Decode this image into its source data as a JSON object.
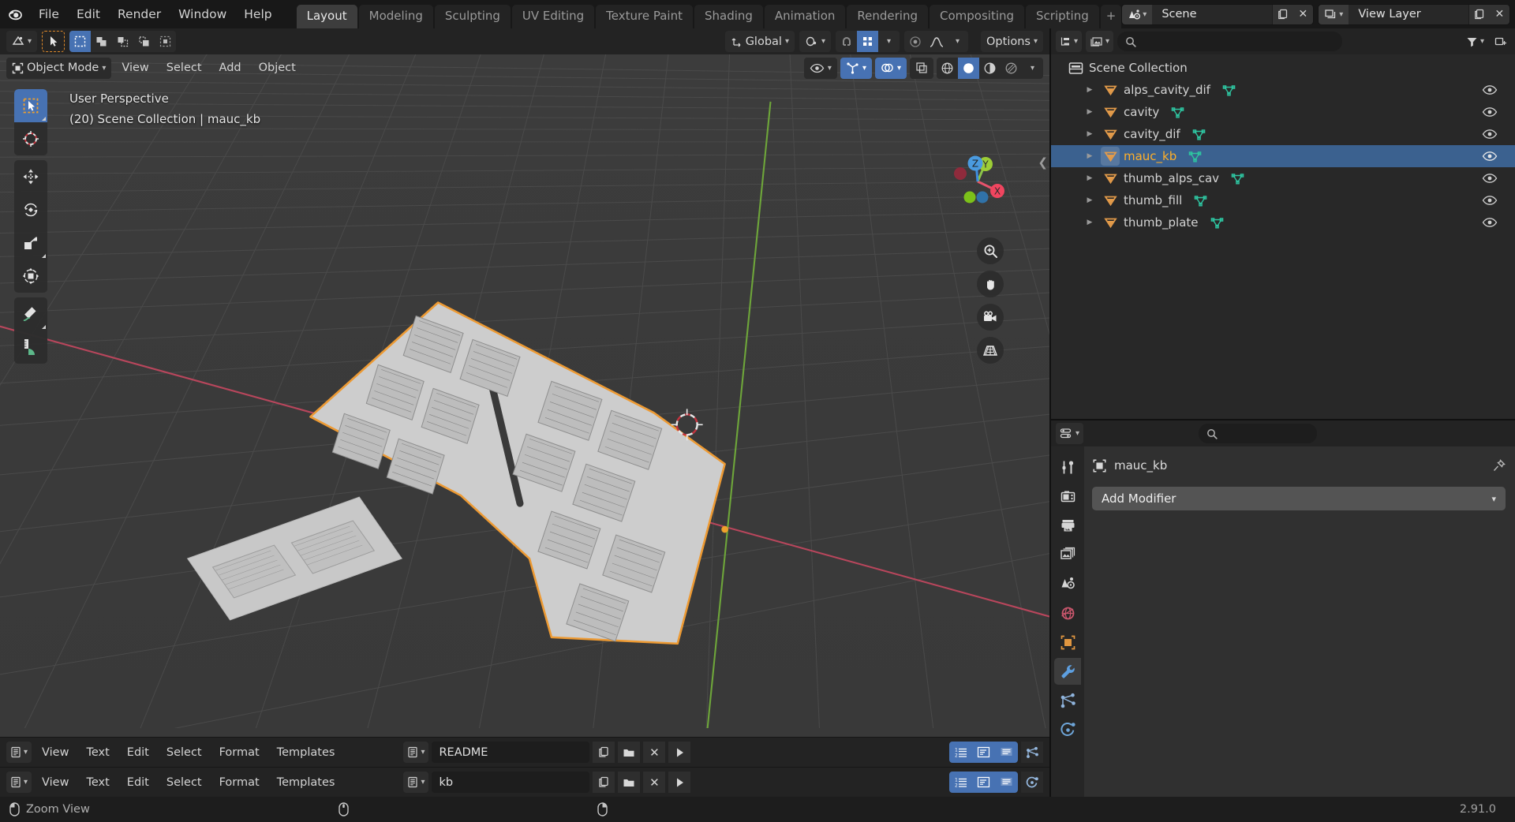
{
  "app": {
    "title": "Blender",
    "version": "2.91.0"
  },
  "topbar": {
    "logo_icon": "blender-logo-icon",
    "menus": [
      "File",
      "Edit",
      "Render",
      "Window",
      "Help"
    ],
    "workspace_tabs": [
      {
        "label": "Layout",
        "active": true
      },
      {
        "label": "Modeling",
        "active": false
      },
      {
        "label": "Sculpting",
        "active": false
      },
      {
        "label": "UV Editing",
        "active": false
      },
      {
        "label": "Texture Paint",
        "active": false
      },
      {
        "label": "Shading",
        "active": false
      },
      {
        "label": "Animation",
        "active": false
      },
      {
        "label": "Rendering",
        "active": false
      },
      {
        "label": "Compositing",
        "active": false
      },
      {
        "label": "Scripting",
        "active": false
      }
    ],
    "scene": {
      "icon": "scene-icon",
      "name": "Scene",
      "new_icon": "copy-icon",
      "unlink_icon": "close-icon"
    },
    "view_layer": {
      "icon": "view-layer-icon",
      "name": "View Layer",
      "new_icon": "copy-icon",
      "unlink_icon": "close-icon"
    }
  },
  "viewport_header": {
    "editor_type_icon": "editor-type-3dview-icon",
    "select_tool_icon": "cursor-arrow-icon",
    "select_modes": [
      "select-box-icon",
      "select-extend-icon",
      "select-subtract-icon",
      "select-invert-icon",
      "select-intersect-icon"
    ],
    "transform_orientation": {
      "icon": "orientation-icon",
      "value": "Global"
    },
    "pivot_icon": "pivot-point-icon",
    "snap_icon": "magnet-icon",
    "snap_to_icon": "snap-grid-icon",
    "proportional_icon": "proportional-edit-icon",
    "falloff_icon": "falloff-curve-icon",
    "options_label": "Options"
  },
  "viewport_header2": {
    "mode": {
      "icon": "object-mode-icon",
      "label": "Object Mode"
    },
    "menus": [
      "View",
      "Select",
      "Add",
      "Object"
    ],
    "visibility_icon": "eye-icon",
    "gizmo_icon": "gizmo-icon",
    "overlays_icon": "overlays-icon",
    "xray_icon": "xray-icon",
    "shading_modes": [
      "shading-wireframe-icon",
      "shading-solid-icon",
      "shading-material-icon",
      "shading-rendered-icon"
    ],
    "shading_active_index": 1
  },
  "viewport": {
    "overlay_line1": "User Perspective",
    "overlay_line2": "(20) Scene Collection | mauc_kb",
    "toolbar": [
      {
        "name": "tweak-tool",
        "icon": "cursor-arrow-icon",
        "active": true
      },
      {
        "name": "cursor-tool",
        "icon": "3d-cursor-icon",
        "active": false
      },
      {
        "name": "move-tool",
        "icon": "move-arrows-icon",
        "active": false
      },
      {
        "name": "rotate-tool",
        "icon": "rotate-icon",
        "active": false
      },
      {
        "name": "scale-tool",
        "icon": "scale-icon",
        "active": false
      },
      {
        "name": "transform-tool",
        "icon": "transform-icon",
        "active": false
      },
      {
        "name": "annotate-tool",
        "icon": "pencil-icon",
        "active": false
      },
      {
        "name": "measure-tool",
        "icon": "ruler-icon",
        "active": false
      }
    ],
    "nav_gizmo": {
      "axes": [
        {
          "label": "X",
          "color": "#e8536c"
        },
        {
          "label": "Y",
          "color": "#8bc34a"
        },
        {
          "label": "Z",
          "color": "#3d8ee0"
        }
      ]
    },
    "nav_buttons": [
      {
        "name": "zoom-button",
        "icon": "zoom-magnifier-icon"
      },
      {
        "name": "pan-button",
        "icon": "hand-icon"
      },
      {
        "name": "camera-view-button",
        "icon": "camera-icon"
      },
      {
        "name": "toggle-perspective-button",
        "icon": "grid-perspective-icon"
      }
    ],
    "collapse_icon": "chevron-left-icon",
    "grid_color": "#4a4a4a",
    "background_color": "#393939",
    "x_axis_color": "#b8465c",
    "y_axis_color": "#6ea63a",
    "selection_outline_color": "#ed9a33",
    "object_color": "#c6c6c6"
  },
  "outliner": {
    "editor_type_icon": "editor-type-outliner-icon",
    "display_mode_icon": "outliner-display-mode-icon",
    "search_icon": "search-icon",
    "search_placeholder": "",
    "filter_icon": "filter-funnel-icon",
    "new_collection_icon": "new-collection-icon",
    "root": {
      "icon": "collection-icon",
      "label": "Scene Collection"
    },
    "items": [
      {
        "label": "alps_cavity_dif",
        "icon": "mesh-object-icon",
        "mesh_icon": "mesh-data-icon",
        "selected": false,
        "visible": true
      },
      {
        "label": "cavity",
        "icon": "mesh-object-icon",
        "mesh_icon": "mesh-data-icon",
        "selected": false,
        "visible": true
      },
      {
        "label": "cavity_dif",
        "icon": "mesh-object-icon",
        "mesh_icon": "mesh-data-icon",
        "selected": false,
        "visible": true
      },
      {
        "label": "mauc_kb",
        "icon": "mesh-object-icon",
        "mesh_icon": "mesh-data-icon",
        "selected": true,
        "visible": true
      },
      {
        "label": "thumb_alps_cav",
        "icon": "mesh-object-icon",
        "mesh_icon": "mesh-data-icon",
        "selected": false,
        "visible": true
      },
      {
        "label": "thumb_fill",
        "icon": "mesh-object-icon",
        "mesh_icon": "mesh-data-icon",
        "selected": false,
        "visible": true
      },
      {
        "label": "thumb_plate",
        "icon": "mesh-object-icon",
        "mesh_icon": "mesh-data-icon",
        "selected": false,
        "visible": true
      }
    ]
  },
  "properties": {
    "editor_type_icon": "editor-type-properties-icon",
    "search_icon": "search-icon",
    "tabs": [
      {
        "name": "tool",
        "icon": "tool-screwdriver-wrench-icon",
        "active": false
      },
      {
        "name": "render",
        "icon": "render-camera-back-icon",
        "active": false
      },
      {
        "name": "output",
        "icon": "output-printer-icon",
        "active": false
      },
      {
        "name": "view-layer",
        "icon": "view-layer-images-icon",
        "active": false
      },
      {
        "name": "scene",
        "icon": "scene-cone-sphere-icon",
        "active": false
      },
      {
        "name": "world",
        "icon": "world-globe-icon",
        "active": false
      },
      {
        "name": "object",
        "icon": "object-square-icon",
        "active": false
      },
      {
        "name": "modifier",
        "icon": "wrench-icon",
        "active": true
      },
      {
        "name": "particles",
        "icon": "particles-icon",
        "active": false
      },
      {
        "name": "physics",
        "icon": "physics-orbit-icon",
        "active": false
      }
    ],
    "breadcrumb": {
      "icon": "object-square-icon",
      "label": "mauc_kb",
      "pin_icon": "pin-icon"
    },
    "add_modifier_label": "Add Modifier",
    "add_modifier_chevron": "chevron-down-icon"
  },
  "text_editors": [
    {
      "editor_type_icon": "editor-type-text-icon",
      "menus": [
        "View",
        "Text",
        "Edit",
        "Select",
        "Format",
        "Templates"
      ],
      "datablock_icon": "text-datablock-icon",
      "filename": "kb",
      "new_icon": "copy-new-icon",
      "open_icon": "folder-open-icon",
      "unlink_icon": "close-x-icon",
      "run_icon": "play-script-icon",
      "toggles": [
        "line-numbers-icon",
        "word-wrap-icon",
        "syntax-highlight-icon"
      ],
      "side_icon": "particles-icon"
    },
    {
      "editor_type_icon": "editor-type-text-icon",
      "menus": [
        "View",
        "Text",
        "Edit",
        "Select",
        "Format",
        "Templates"
      ],
      "datablock_icon": "text-datablock-icon",
      "filename": "README",
      "new_icon": "copy-new-icon",
      "open_icon": "folder-open-icon",
      "unlink_icon": "close-x-icon",
      "run_icon": "play-script-icon",
      "toggles": [
        "line-numbers-icon",
        "word-wrap-icon",
        "syntax-highlight-icon"
      ],
      "side_icon": "physics-orbit-icon"
    }
  ],
  "statusbar": {
    "mouse_icon_left": "mouse-left-button-icon",
    "hint_label": "Zoom View",
    "mouse_icon_middle": "mouse-middle-button-icon",
    "mouse_icon_right": "mouse-right-button-icon",
    "version": "2.91.0"
  }
}
